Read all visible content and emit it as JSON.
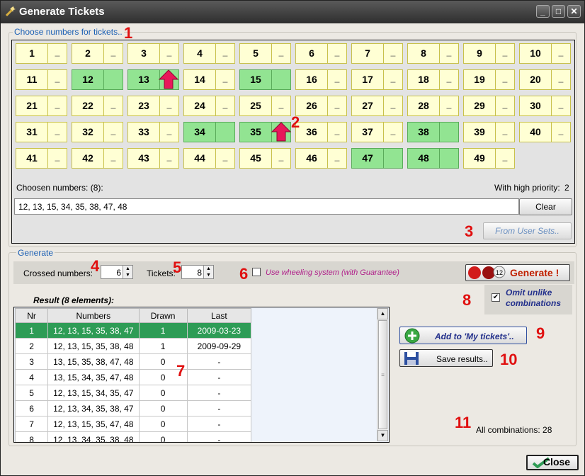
{
  "window": {
    "title": "Generate Tickets",
    "minimize": "_",
    "maximize": "□",
    "close": "✕"
  },
  "choose": {
    "group_label": "Choose numbers for tickets..",
    "cells": [
      {
        "num": "1",
        "mark": "_",
        "sel": false
      },
      {
        "num": "2",
        "mark": "_",
        "sel": false
      },
      {
        "num": "3",
        "mark": "_",
        "sel": false
      },
      {
        "num": "4",
        "mark": "_",
        "sel": false
      },
      {
        "num": "5",
        "mark": "_",
        "sel": false
      },
      {
        "num": "6",
        "mark": "_",
        "sel": false
      },
      {
        "num": "7",
        "mark": "_",
        "sel": false
      },
      {
        "num": "8",
        "mark": "_",
        "sel": false
      },
      {
        "num": "9",
        "mark": "_",
        "sel": false
      },
      {
        "num": "10",
        "mark": "_",
        "sel": false
      },
      {
        "num": "11",
        "mark": "_",
        "sel": false
      },
      {
        "num": "12",
        "mark": "",
        "sel": true
      },
      {
        "num": "13",
        "mark": "",
        "sel": true,
        "priority": true
      },
      {
        "num": "14",
        "mark": "_",
        "sel": false
      },
      {
        "num": "15",
        "mark": "",
        "sel": true
      },
      {
        "num": "16",
        "mark": "_",
        "sel": false
      },
      {
        "num": "17",
        "mark": "_",
        "sel": false
      },
      {
        "num": "18",
        "mark": "_",
        "sel": false
      },
      {
        "num": "19",
        "mark": "_",
        "sel": false
      },
      {
        "num": "20",
        "mark": "_",
        "sel": false
      },
      {
        "num": "21",
        "mark": "_",
        "sel": false
      },
      {
        "num": "22",
        "mark": "_",
        "sel": false
      },
      {
        "num": "23",
        "mark": "_",
        "sel": false
      },
      {
        "num": "24",
        "mark": "_",
        "sel": false
      },
      {
        "num": "25",
        "mark": "_",
        "sel": false
      },
      {
        "num": "26",
        "mark": "_",
        "sel": false
      },
      {
        "num": "27",
        "mark": "_",
        "sel": false
      },
      {
        "num": "28",
        "mark": "_",
        "sel": false
      },
      {
        "num": "29",
        "mark": "_",
        "sel": false
      },
      {
        "num": "30",
        "mark": "_",
        "sel": false
      },
      {
        "num": "31",
        "mark": "_",
        "sel": false
      },
      {
        "num": "32",
        "mark": "_",
        "sel": false
      },
      {
        "num": "33",
        "mark": "_",
        "sel": false
      },
      {
        "num": "34",
        "mark": "",
        "sel": true
      },
      {
        "num": "35",
        "mark": "",
        "sel": true,
        "priority": true
      },
      {
        "num": "36",
        "mark": "_",
        "sel": false
      },
      {
        "num": "37",
        "mark": "_",
        "sel": false
      },
      {
        "num": "38",
        "mark": "",
        "sel": true
      },
      {
        "num": "39",
        "mark": "_",
        "sel": false
      },
      {
        "num": "40",
        "mark": "_",
        "sel": false
      },
      {
        "num": "41",
        "mark": "_",
        "sel": false
      },
      {
        "num": "42",
        "mark": "_",
        "sel": false
      },
      {
        "num": "43",
        "mark": "_",
        "sel": false
      },
      {
        "num": "44",
        "mark": "_",
        "sel": false
      },
      {
        "num": "45",
        "mark": "_",
        "sel": false
      },
      {
        "num": "46",
        "mark": "_",
        "sel": false
      },
      {
        "num": "47",
        "mark": "",
        "sel": true
      },
      {
        "num": "48",
        "mark": "",
        "sel": true
      },
      {
        "num": "49",
        "mark": "_",
        "sel": false
      }
    ],
    "chosen_label": "Choosen numbers: (8):",
    "priority_label": "With high priority:",
    "priority_count": "2",
    "chosen_value": "12, 13, 15, 34, 35, 38, 47, 48",
    "clear_label": "Clear",
    "from_user_sets_label": "From User Sets.."
  },
  "generate": {
    "group_label": "Generate",
    "crossed_label": "Crossed numbers:",
    "crossed_value": "6",
    "tickets_label": "Tickets:",
    "tickets_value": "8",
    "wheeling_label": "Use wheeling system (with Guarantee)",
    "generate_button": "Generate !",
    "generate_badge": "12",
    "omit_label_1": "Omit unlike",
    "omit_label_2": "combinations",
    "result_label": "Result  (8 elements):",
    "columns": [
      "Nr",
      "Numbers",
      "Drawn",
      "Last"
    ],
    "rows": [
      {
        "nr": "1",
        "numbers": "12, 13, 15, 35, 38, 47",
        "drawn": "1",
        "last": "2009-03-23"
      },
      {
        "nr": "2",
        "numbers": "12, 13, 15, 35, 38, 48",
        "drawn": "1",
        "last": "2009-09-29"
      },
      {
        "nr": "3",
        "numbers": "13, 15, 35, 38, 47, 48",
        "drawn": "0",
        "last": "-"
      },
      {
        "nr": "4",
        "numbers": "13, 15, 34, 35, 47, 48",
        "drawn": "0",
        "last": "-"
      },
      {
        "nr": "5",
        "numbers": "12, 13, 15, 34, 35, 47",
        "drawn": "0",
        "last": "-"
      },
      {
        "nr": "6",
        "numbers": "12, 13, 34, 35, 38, 47",
        "drawn": "0",
        "last": "-"
      },
      {
        "nr": "7",
        "numbers": "12, 13, 15, 35, 47, 48",
        "drawn": "0",
        "last": "-"
      },
      {
        "nr": "8",
        "numbers": "12, 13, 34, 35, 38, 48",
        "drawn": "0",
        "last": "-"
      }
    ],
    "add_label": "Add to 'My tickets'..",
    "save_label": "Save results..",
    "all_comb_label": "All combinations: 28"
  },
  "close_label": "Close",
  "callouts": [
    "1",
    "2",
    "3",
    "4",
    "5",
    "6",
    "7",
    "8",
    "9",
    "10",
    "11"
  ],
  "colors": {
    "selected": "#92e492",
    "cell": "#ffffd4",
    "callout": "#e01010",
    "row_highlight": "#2e9c56"
  }
}
